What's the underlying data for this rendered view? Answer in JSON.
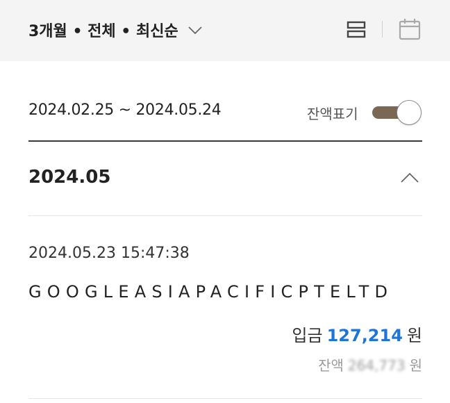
{
  "toolbar": {
    "filter_label": "3개월 • 전체 • 최신순",
    "chevron_icon": "chevron-down-icon",
    "list_icon": "list-view-icon",
    "calendar_icon": "calendar-icon"
  },
  "range": {
    "text": "2024.02.25 ~ 2024.05.24",
    "balance_toggle_label": "잔액표기",
    "balance_toggle_on": true
  },
  "month_section": {
    "label": "2024.05",
    "collapse_icon": "chevron-up-icon"
  },
  "transactions": [
    {
      "datetime": "2024.05.23 15:47:38",
      "description": "GOOGLEASIAPACIFICPTELTD",
      "type_label": "입금",
      "amount": "127,214",
      "currency": "원",
      "balance_label": "잔액",
      "balance_value": "264,773",
      "balance_currency": "원"
    }
  ],
  "colors": {
    "accent_blue": "#1d76d6",
    "toggle_track": "#7a6754",
    "topbar_bg": "#f4f4f4"
  }
}
